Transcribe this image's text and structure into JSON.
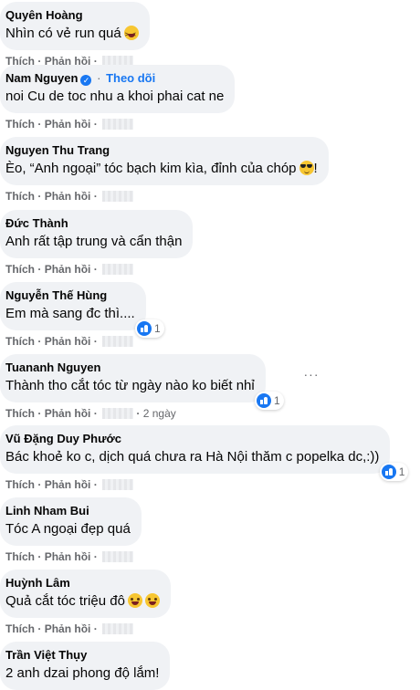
{
  "actions": {
    "like": "Thích",
    "reply": "Phản hồi",
    "separator": "·"
  },
  "comments": [
    {
      "author": "Quyên Hoàng",
      "text": "Nhìn có vẻ run quá",
      "emoji": "squint-laugh-emoji"
    },
    {
      "author": "Nam Nguyen",
      "verified": true,
      "follow_label": "Theo dõi",
      "text": "noi Cu de toc nhu a khoi phai cat ne"
    },
    {
      "author": "Nguyen Thu Trang",
      "text": "Èo, “Anh ngoại” tóc bạch kim kìa, đỉnh của chóp",
      "emoji": "sunglasses-emoji",
      "text_suffix": "!"
    },
    {
      "author": "Đức Thành",
      "text": "Anh rất tập trung và cẩn thận"
    },
    {
      "author": "Nguyễn Thế Hùng",
      "text": "Em mà sang đc thì....",
      "reactions": "1"
    },
    {
      "author": "Tuananh Nguyen",
      "text": "Thành tho cắt tóc từ ngày nào ko biết nhỉ",
      "reactions": "1",
      "time": "2 ngày",
      "more_label": "···"
    },
    {
      "author": "Vũ Đặng Duy Phước",
      "text": "Bác khoẻ ko c, dịch quá chưa ra Hà Nội thăm c popelka dc,:))",
      "reactions": "1"
    },
    {
      "author": "Linh Nham Bui",
      "text": "Tóc A ngoại đẹp quá"
    },
    {
      "author": "Huỳnh Lâm",
      "text": "Quả cắt tóc triệu đô",
      "emoji": "grinning-emoji"
    },
    {
      "author": "Trần Việt Thụy",
      "text": "2 anh dzai phong độ lắm!"
    }
  ]
}
